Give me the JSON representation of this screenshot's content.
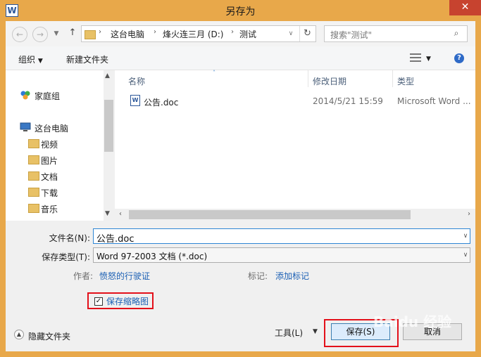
{
  "window": {
    "title": "另存为",
    "app_icon": "W"
  },
  "nav": {
    "breadcrumbs": [
      "这台电脑",
      "烽火连三月 (D:)",
      "测试"
    ],
    "search_placeholder": "搜索\"测试\""
  },
  "toolbar": {
    "organize": "组织",
    "new_folder": "新建文件夹"
  },
  "sidebar": {
    "homegroup": "家庭组",
    "this_pc": "这台电脑",
    "items": [
      "视频",
      "图片",
      "文档",
      "下载",
      "音乐"
    ]
  },
  "columns": {
    "name": "名称",
    "modified": "修改日期",
    "type": "类型"
  },
  "files": [
    {
      "name": "公告.doc",
      "modified": "2014/5/21 15:59",
      "type": "Microsoft Word ..."
    }
  ],
  "form": {
    "filename_label": "文件名(N):",
    "filename_value": "公告.doc",
    "filetype_label": "保存类型(T):",
    "filetype_value": "Word 97-2003 文档 (*.doc)",
    "author_label": "作者:",
    "author_value": "愤怒的行驶证",
    "tags_label": "标记:",
    "tags_value": "添加标记",
    "thumbnail_label": "保存缩略图"
  },
  "footer": {
    "hide_folders": "隐藏文件夹",
    "tools": "工具(L)",
    "save": "保存(S)",
    "cancel": "取消"
  },
  "colors": {
    "title_bar": "#e8a84a",
    "close_button": "#c7432f",
    "highlight_box": "#e3101a",
    "link": "#1a5fb4"
  },
  "watermark": "Baidu 经验"
}
